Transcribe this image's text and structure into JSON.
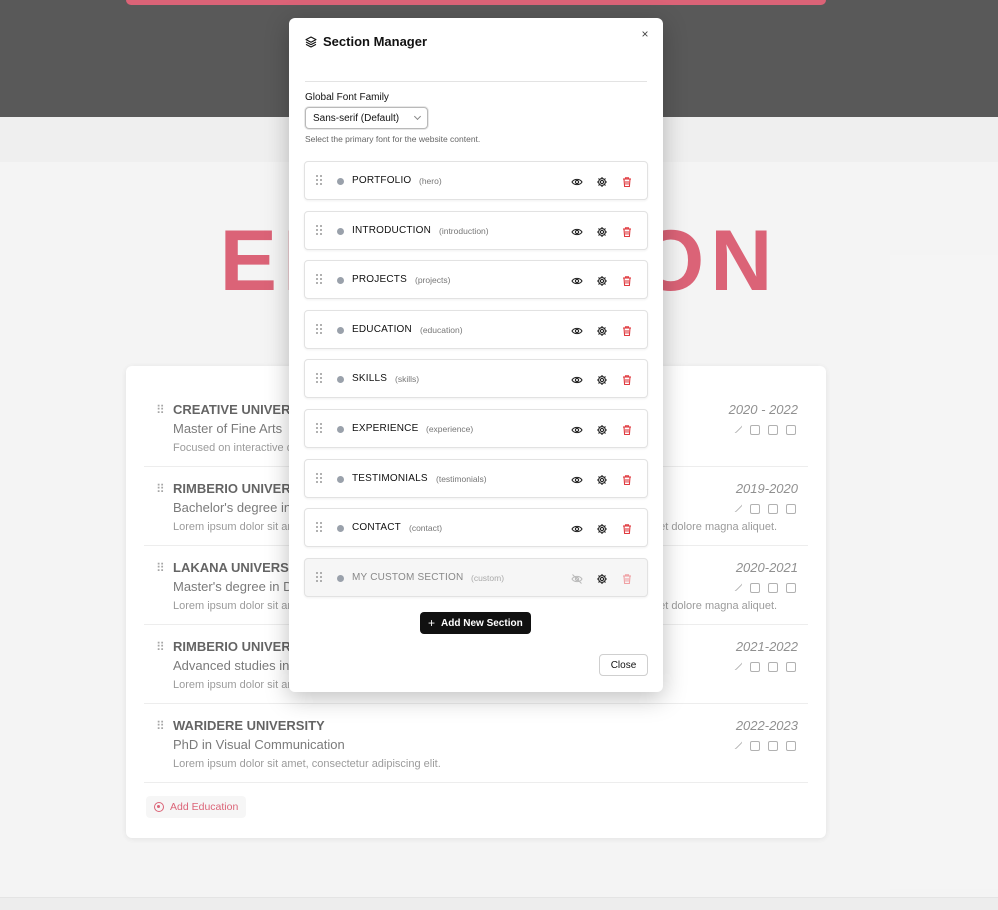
{
  "background": {
    "big_title": "EDUCATION",
    "education": [
      {
        "school": "CREATIVE UNIVERSITY",
        "degree": "Master of Fine Arts",
        "desc": "Focused on interactive design.",
        "year": "2020 - 2022"
      },
      {
        "school": "RIMBERIO UNIVERSITY",
        "degree": "Bachelor's degree in Graphic Design",
        "desc": "Lorem ipsum dolor sit amet, consectetur adipiscing elit. Sed do eiusmod tempor incididunt ut labore et dolore magna aliquet.",
        "year": "2019-2020"
      },
      {
        "school": "LAKANA UNIVERSITY",
        "degree": "Master's degree in Digital Media",
        "desc": "Lorem ipsum dolor sit amet, consectetur adipiscing elit. Sed do eiusmod tempor incididunt ut labore et dolore magna aliquet.",
        "year": "2020-2021"
      },
      {
        "school": "RIMBERIO UNIVERSITY",
        "degree": "Advanced studies in Visual Arts",
        "desc": "Lorem ipsum dolor sit amet, consectetur adipiscing elit.",
        "year": "2021-2022"
      },
      {
        "school": "WARIDERE UNIVERSITY",
        "degree": "PhD in Visual Communication",
        "desc": "Lorem ipsum dolor sit amet, consectetur adipiscing elit.",
        "year": "2022-2023"
      }
    ],
    "add_education_label": "Add Education"
  },
  "modal": {
    "title": "Section Manager",
    "title_icon": "layers-icon",
    "close_glyph": "×",
    "font_label": "Global Font Family",
    "font_value": "Sans-serif (Default)",
    "font_help": "Select the primary font for the website content.",
    "sections": [
      {
        "name": "PORTFOLIO",
        "key": "(hero)",
        "visible": true
      },
      {
        "name": "INTRODUCTION",
        "key": "(introduction)",
        "visible": true
      },
      {
        "name": "PROJECTS",
        "key": "(projects)",
        "visible": true
      },
      {
        "name": "EDUCATION",
        "key": "(education)",
        "visible": true
      },
      {
        "name": "SKILLS",
        "key": "(skills)",
        "visible": true
      },
      {
        "name": "EXPERIENCE",
        "key": "(experience)",
        "visible": true
      },
      {
        "name": "TESTIMONIALS",
        "key": "(testimonials)",
        "visible": true
      },
      {
        "name": "CONTACT",
        "key": "(contact)",
        "visible": true
      },
      {
        "name": "MY CUSTOM SECTION",
        "key": "(custom)",
        "visible": false
      }
    ],
    "add_section_label": "Add New Section",
    "close_label": "Close"
  },
  "colors": {
    "accent_red": "#c8102e",
    "header_black": "#000000",
    "primary_button": "#111111",
    "dot_gray": "#9aa1ab"
  }
}
